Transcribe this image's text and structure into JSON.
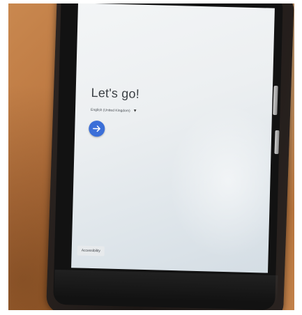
{
  "setup": {
    "title": "Let's go!",
    "language": "English (United Kingdom)",
    "next_icon": "arrow-right-icon",
    "accessibility_label": "Accessibility",
    "accent_color": "#3b6fd8"
  }
}
